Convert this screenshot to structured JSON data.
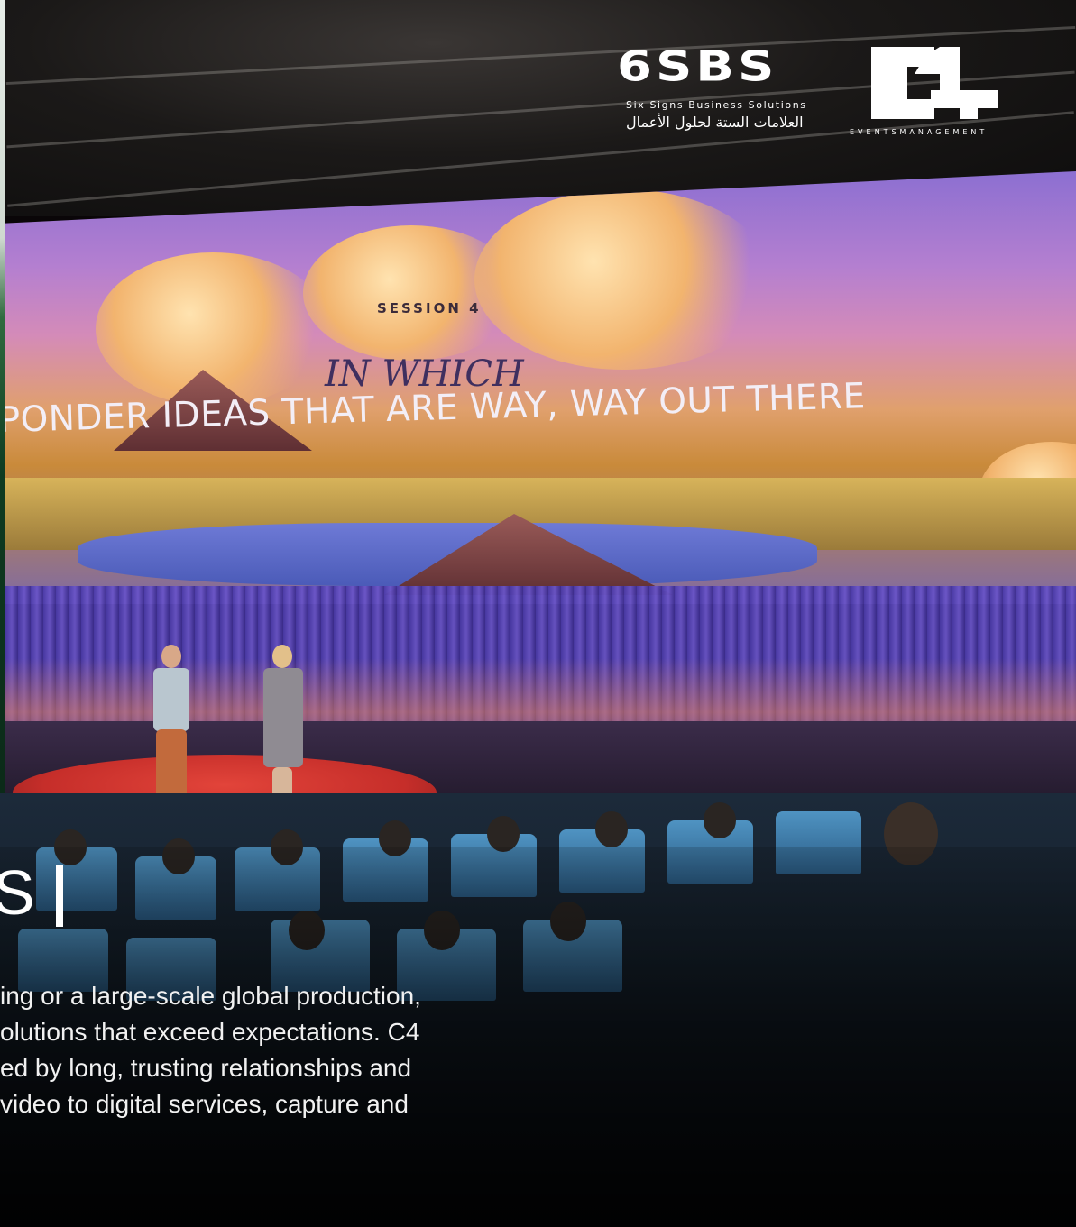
{
  "logos": {
    "sixsbs": {
      "mark": "6SBS",
      "english": "Six Signs Business Solutions",
      "arabic": "العلامات الستة لحلول الأعمال"
    },
    "c4": {
      "subtitle": "EVENTSMANAGEMENT"
    }
  },
  "screen": {
    "session": "SESSION 4",
    "line1": "IN WHICH",
    "line2": "PONDER IDEAS THAT ARE WAY, WAY OUT THERE"
  },
  "content": {
    "heading_fragment": "S",
    "body_lines": [
      "ing or a large-scale global production,",
      "olutions that exceed expectations. C4",
      "ed by long, trusting relationships and",
      "video to digital services, capture and"
    ]
  },
  "colors": {
    "stage_red": "#c62e2a",
    "curtain_purple": "#5a46b8",
    "seat_blue": "#4f93c2",
    "text_white": "#ffffff"
  }
}
